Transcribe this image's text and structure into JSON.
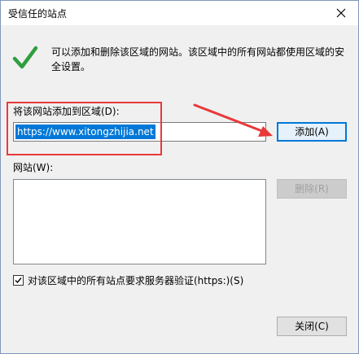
{
  "window": {
    "title": "受信任的站点",
    "close_symbol": "✕"
  },
  "info": {
    "text": "可以添加和删除该区域的网站。该区域中的所有网站都使用区域的安全设置。"
  },
  "add": {
    "label": "将该网站添加到区域(D):",
    "url_value": "https://www.xitongzhijia.net",
    "button_label": "添加(A)"
  },
  "sites": {
    "label": "网站(W):",
    "items": [],
    "remove_label": "删除(R)"
  },
  "https_check": {
    "label": "对该区域中的所有站点要求服务器验证(https:)(S)",
    "checked": true
  },
  "footer": {
    "close_label": "关闭(C)"
  },
  "colors": {
    "accent": "#0078d7",
    "check_green": "#2f9e3f",
    "annotation_red": "#e8393a"
  },
  "icons": {
    "status": "checkmark-icon",
    "close": "close-icon"
  }
}
